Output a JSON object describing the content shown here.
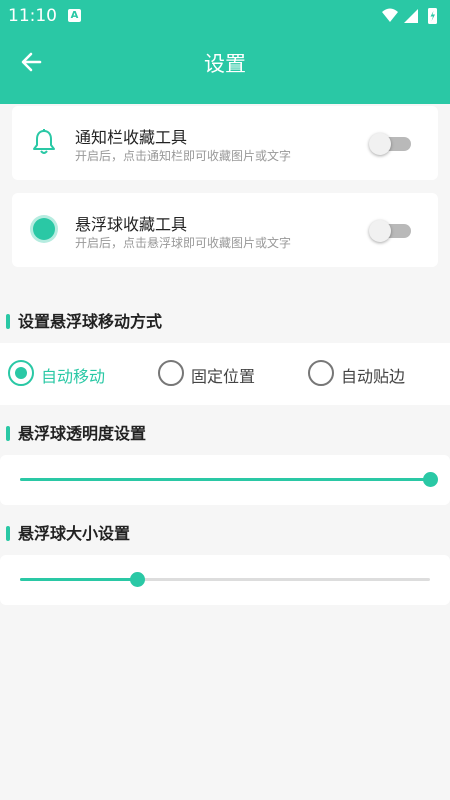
{
  "status_bar": {
    "time": "11:10",
    "a_icon": "A"
  },
  "header": {
    "title": "设置"
  },
  "notification_card": {
    "title": "通知栏收藏工具",
    "subtitle": "开启后，点击通知栏即可收藏图片或文字",
    "enabled": false
  },
  "float_card": {
    "title": "悬浮球收藏工具",
    "subtitle": "开启后，点击悬浮球即可收藏图片或文字",
    "enabled": false
  },
  "move_section": {
    "title": "设置悬浮球移动方式",
    "options": [
      "自动移动",
      "固定位置",
      "自动贴边"
    ],
    "selected": "自动移动"
  },
  "opacity_section": {
    "title": "悬浮球透明度设置",
    "value_fraction": 1.0
  },
  "size_section": {
    "title": "悬浮球大小设置",
    "value_fraction": 0.285
  },
  "colors": {
    "accent": "#2ac8a5",
    "background": "#f6f6f6"
  }
}
